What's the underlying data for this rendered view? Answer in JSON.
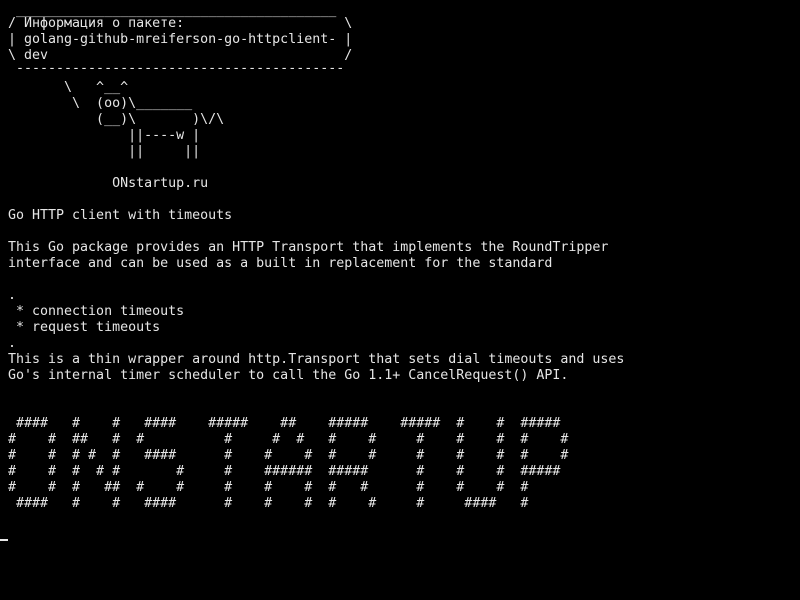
{
  "terminal": {
    "background": "#000000",
    "foreground": "#e6e6e6",
    "lines": [
      " ________________________________________",
      "/ Информация о пакете:                    \\",
      "| golang-github-mreiferson-go-httpclient- |",
      "\\ dev                                     /",
      " -----------------------------------------",
      "       \\   ^__^",
      "        \\  (oo)\\_______",
      "           (__)\\       )\\/\\",
      "               ||----w |",
      "               ||     ||",
      "",
      "             ONstartup.ru",
      "",
      "Go HTTP client with timeouts",
      "",
      "This Go package provides an HTTP Transport that implements the RoundTripper",
      "interface and can be used as a built in replacement for the standard",
      "",
      ".",
      " * connection timeouts",
      " * request timeouts",
      ".",
      "This is a thin wrapper around http.Transport that sets dial timeouts and uses",
      "Go's internal timer scheduler to call the Go 1.1+ CancelRequest() API.",
      "",
      "",
      " ####   #    #   ####    #####    ##    #####    #####  #    #  #####",
      "#    #  ##   #  #          #     #  #   #    #     #    #    #  #    #",
      "#    #  # #  #   ####      #    #    #  #    #     #    #    #  #    #",
      "#    #  #  # #       #     #    ######  #####      #    #    #  #####",
      "#    #  #   ##  #    #     #    #    #  #   #      #    #    #  #",
      " ####   #    #   ####      #    #    #  #    #     #     ####   #"
    ]
  }
}
